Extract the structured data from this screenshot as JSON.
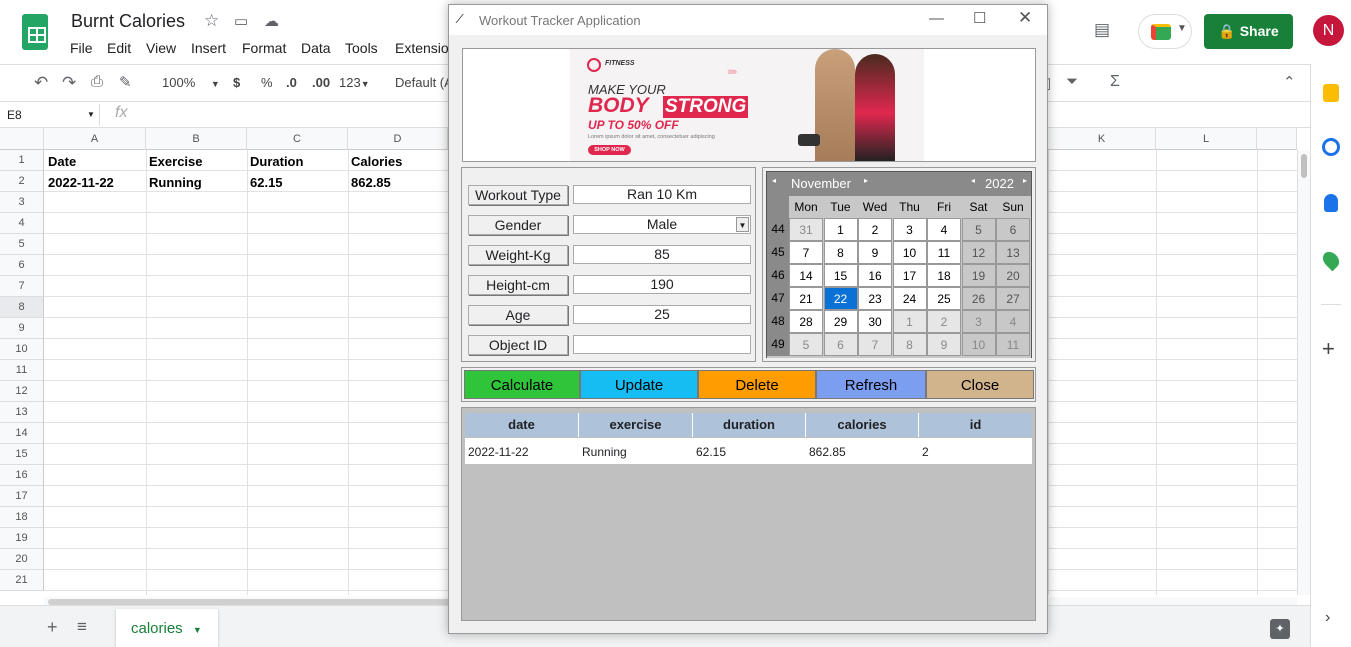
{
  "sheets": {
    "title": "Burnt Calories",
    "menu": [
      "File",
      "Edit",
      "View",
      "Insert",
      "Format",
      "Data",
      "Tools",
      "Extensio"
    ],
    "zoom": "100%",
    "toolbar_currency": "$",
    "toolbar_percent": "%",
    "toolbar_dec_less": ".0",
    "toolbar_dec_more": ".00",
    "toolbar_format": "123",
    "font": "Default (A",
    "cell_ref": "E8",
    "fx": "fx",
    "columns": [
      "A",
      "B",
      "C",
      "D",
      "K",
      "L"
    ],
    "rows": [
      "1",
      "2",
      "3",
      "4",
      "5",
      "6",
      "7",
      "8",
      "9",
      "10",
      "11",
      "12",
      "13",
      "14",
      "15",
      "16",
      "17",
      "18",
      "19",
      "20",
      "21"
    ],
    "header_row": [
      "Date",
      "Exercise",
      "Duration",
      "Calories"
    ],
    "data_row": [
      "2022-11-22",
      "Running",
      "62.15",
      "862.85"
    ],
    "sheet_tab": "calories",
    "share": "Share",
    "avatar": "N"
  },
  "app": {
    "window_title": "Workout Tracker Application",
    "banner": {
      "brand": "FITNESS",
      "line1": "MAKE YOUR",
      "line2a": "BODY",
      "line2b": "STRONG",
      "line3": "UP TO 50% OFF",
      "small": "Lorem ipsum dolor sit amet, consectetuer adipiscing",
      "btn": "SHOP NOW"
    },
    "form": {
      "workout_label": "Workout Type",
      "workout_value": "Ran 10 Km",
      "gender_label": "Gender",
      "gender_value": "Male",
      "weight_label": "Weight-Kg",
      "weight_value": "85",
      "height_label": "Height-cm",
      "height_value": "190",
      "age_label": "Age",
      "age_value": "25",
      "objid_label": "Object ID",
      "objid_value": ""
    },
    "calendar": {
      "month": "November",
      "year": "2022",
      "day_names": [
        "Mon",
        "Tue",
        "Wed",
        "Thu",
        "Fri",
        "Sat",
        "Sun"
      ],
      "weeks": [
        {
          "wk": "44",
          "days": [
            "31",
            "1",
            "2",
            "3",
            "4",
            "5",
            "6"
          ]
        },
        {
          "wk": "45",
          "days": [
            "7",
            "8",
            "9",
            "10",
            "11",
            "12",
            "13"
          ]
        },
        {
          "wk": "46",
          "days": [
            "14",
            "15",
            "16",
            "17",
            "18",
            "19",
            "20"
          ]
        },
        {
          "wk": "47",
          "days": [
            "21",
            "22",
            "23",
            "24",
            "25",
            "26",
            "27"
          ]
        },
        {
          "wk": "48",
          "days": [
            "28",
            "29",
            "30",
            "1",
            "2",
            "3",
            "4"
          ]
        },
        {
          "wk": "49",
          "days": [
            "5",
            "6",
            "7",
            "8",
            "9",
            "10",
            "11"
          ]
        }
      ],
      "selected": "22"
    },
    "buttons": {
      "calculate": "Calculate",
      "update": "Update",
      "delete": "Delete",
      "refresh": "Refresh",
      "close": "Close"
    },
    "button_colors": {
      "calculate": "#2fc43a",
      "update": "#15bdf2",
      "delete": "#ff9d00",
      "refresh": "#7b9ef0",
      "close": "#d1b48c"
    },
    "table": {
      "headers": [
        "date",
        "exercise",
        "duration",
        "calories",
        "id"
      ],
      "row": [
        "2022-11-22",
        "Running",
        "62.15",
        "862.85",
        "2"
      ]
    }
  }
}
